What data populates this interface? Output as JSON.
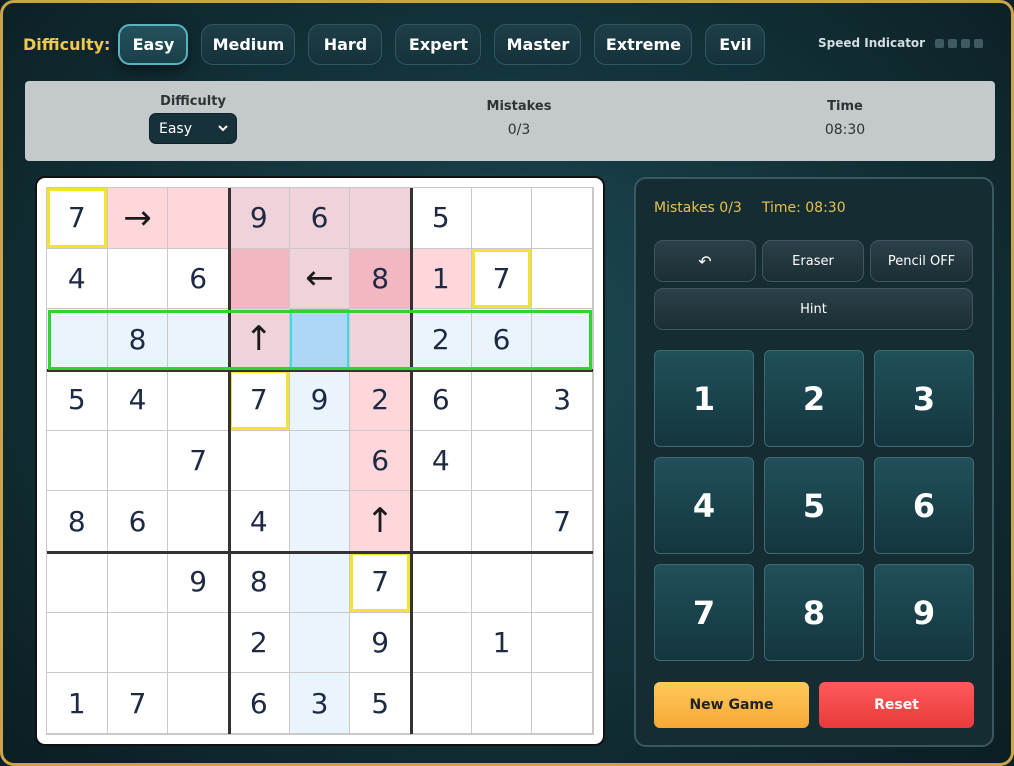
{
  "header": {
    "difficulty_label": "Difficulty:",
    "levels": [
      {
        "label": "Easy",
        "active": true
      },
      {
        "label": "Medium",
        "active": false
      },
      {
        "label": "Hard",
        "active": false
      },
      {
        "label": "Expert",
        "active": false
      },
      {
        "label": "Master",
        "active": false
      },
      {
        "label": "Extreme",
        "active": false
      },
      {
        "label": "Evil",
        "active": false
      }
    ],
    "speed_label": "Speed Indicator",
    "speed_dots": 4
  },
  "info": {
    "difficulty_title": "Difficulty",
    "difficulty_value": "Easy",
    "mistakes_title": "Mistakes",
    "mistakes_value": "0/3",
    "time_title": "Time",
    "time_value": "08:30"
  },
  "board": {
    "cells": [
      [
        "7",
        "→",
        "",
        "9",
        "6",
        "",
        "5",
        "",
        ""
      ],
      [
        "4",
        "",
        "6",
        "",
        "←",
        "8",
        "1",
        "7",
        ""
      ],
      [
        "",
        "8",
        "",
        "↑",
        "",
        "",
        "2",
        "6",
        ""
      ],
      [
        "5",
        "4",
        "",
        "7",
        "9",
        "2",
        "6",
        "",
        "3"
      ],
      [
        "",
        "",
        "7",
        "",
        "",
        "6",
        "4",
        "",
        ""
      ],
      [
        "8",
        "6",
        "",
        "4",
        "",
        "↑",
        "",
        "",
        "7"
      ],
      [
        "",
        "",
        "9",
        "8",
        "",
        "7",
        "",
        "",
        ""
      ],
      [
        "",
        "",
        "",
        "2",
        "",
        "9",
        "",
        "1",
        ""
      ],
      [
        "1",
        "7",
        "",
        "6",
        "3",
        "5",
        "",
        "",
        ""
      ]
    ],
    "cell_colors": [
      [
        "#ffffff",
        "#ffd6da",
        "#ffd6da",
        "#f0d3da",
        "#f0d3da",
        "#f0d3da",
        "#ffffff",
        "#ffffff",
        "#ffffff"
      ],
      [
        "#ffffff",
        "#ffffff",
        "#ffffff",
        "#f2b7c0",
        "#f0d3da",
        "#f2b7c0",
        "#ffd6da",
        "#ffffff",
        "#ffffff"
      ],
      [
        "#eaf4fd",
        "#eaf4fd",
        "#eaf4fd",
        "#f0d3da",
        "#aed6f7",
        "#f0d3da",
        "#eaf4fd",
        "#eaf4fd",
        "#eaf4fd"
      ],
      [
        "#ffffff",
        "#ffffff",
        "#ffffff",
        "#ffffff",
        "#eaf4fd",
        "#ffd6da",
        "#ffffff",
        "#ffffff",
        "#ffffff"
      ],
      [
        "#ffffff",
        "#ffffff",
        "#ffffff",
        "#ffffff",
        "#eaf4fd",
        "#ffd6da",
        "#ffffff",
        "#ffffff",
        "#ffffff"
      ],
      [
        "#ffffff",
        "#ffffff",
        "#ffffff",
        "#ffffff",
        "#eaf4fd",
        "#ffd6da",
        "#ffffff",
        "#ffffff",
        "#ffffff"
      ],
      [
        "#ffffff",
        "#ffffff",
        "#ffffff",
        "#ffffff",
        "#eaf4fd",
        "#ffffff",
        "#ffffff",
        "#ffffff",
        "#ffffff"
      ],
      [
        "#ffffff",
        "#ffffff",
        "#ffffff",
        "#ffffff",
        "#eaf4fd",
        "#ffffff",
        "#ffffff",
        "#ffffff",
        "#ffffff"
      ],
      [
        "#ffffff",
        "#ffffff",
        "#ffffff",
        "#ffffff",
        "#eaf4fd",
        "#ffffff",
        "#ffffff",
        "#ffffff",
        "#ffffff"
      ]
    ],
    "yellow_outlined": [
      [
        0,
        0
      ],
      [
        1,
        7
      ],
      [
        3,
        3
      ],
      [
        6,
        5
      ]
    ],
    "selected_cell": [
      2,
      4
    ],
    "highlight_row": 2,
    "accent_colors": {
      "yellow_outline": "#f5e52a",
      "row_outline": "#2fd42f",
      "selected_outline": "#3fd9e0"
    }
  },
  "panel": {
    "mistakes_text": "Mistakes 0/3",
    "time_text": "Time: 08:30",
    "undo_icon": "↶",
    "eraser_label": "Eraser",
    "pencil_label": "Pencil OFF",
    "hint_label": "Hint",
    "numbers": [
      "1",
      "2",
      "3",
      "4",
      "5",
      "6",
      "7",
      "8",
      "9"
    ],
    "new_game_label": "New Game",
    "reset_label": "Reset"
  }
}
